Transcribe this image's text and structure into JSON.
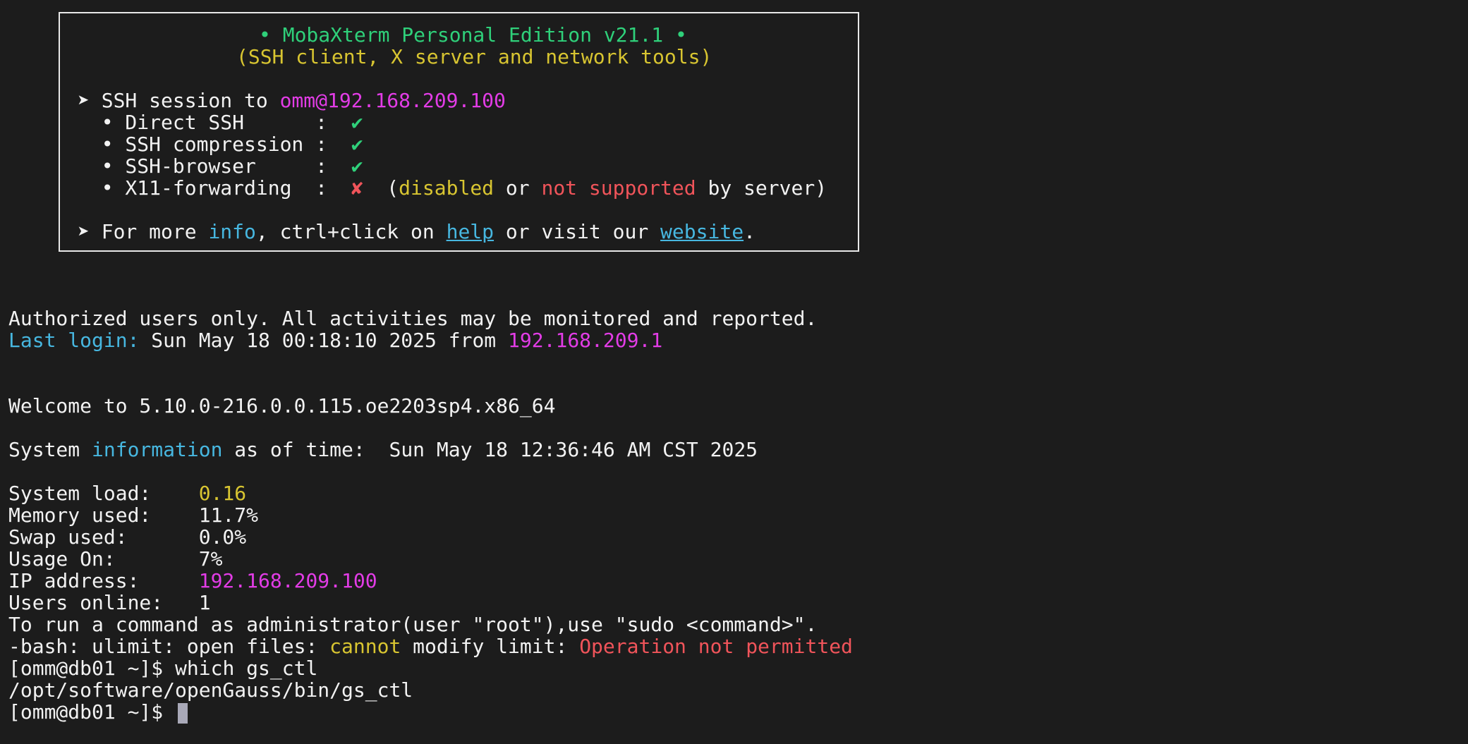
{
  "banner": {
    "title": "• MobaXterm Personal Edition v21.1 •",
    "subtitle": "(SSH client, X server and network tools)",
    "ssh_prefix": "➤ SSH session to ",
    "ssh_target": "omm@192.168.209.100",
    "features": [
      {
        "label": "  • Direct SSH      :  ",
        "mark": "✔",
        "status": "ok"
      },
      {
        "label": "  • SSH compression :  ",
        "mark": "✔",
        "status": "ok"
      },
      {
        "label": "  • SSH-browser     :  ",
        "mark": "✔",
        "status": "ok"
      },
      {
        "label": "  • X11-forwarding  :  ",
        "mark": "✘",
        "status": "fail"
      }
    ],
    "x11_note_open": "  (",
    "x11_disabled": "disabled",
    "x11_or": " or ",
    "x11_not_supported": "not supported",
    "x11_by_server": " by server)",
    "info_prefix": "➤ For more ",
    "info_word": "info",
    "info_mid": ", ctrl+click on ",
    "help_link": "help",
    "info_mid2": " or visit our ",
    "website_link": "website",
    "info_end": "."
  },
  "motd": {
    "authorized": "Authorized users only. All activities may be monitored and reported.",
    "last_login_label": "Last login:",
    "last_login_value": " Sun May 18 00:18:10 2025 from ",
    "last_login_ip": "192.168.209.1",
    "welcome": "Welcome to 5.10.0-216.0.0.115.oe2203sp4.x86_64",
    "sysinfo_prefix": "System ",
    "sysinfo_word": "information",
    "sysinfo_suffix": " as of time:  Sun May 18 12:36:46 AM CST 2025",
    "stats": [
      {
        "label": "System load:    ",
        "value": "0.16",
        "color": "yellow"
      },
      {
        "label": "Memory used:    ",
        "value": "11.7%",
        "color": "white"
      },
      {
        "label": "Swap used:      ",
        "value": "0.0%",
        "color": "white"
      },
      {
        "label": "Usage On:       ",
        "value": "7%",
        "color": "white"
      },
      {
        "label": "IP address:     ",
        "value": "192.168.209.100",
        "color": "magenta"
      },
      {
        "label": "Users online:   ",
        "value": "1",
        "color": "white"
      }
    ],
    "sudo_hint": "To run a command as administrator(user \"root\"),use \"sudo <command>\"."
  },
  "shell": {
    "ulimit_prefix": "-bash: ulimit: open files: ",
    "ulimit_cannot": "cannot",
    "ulimit_mid": " modify limit: ",
    "ulimit_error": "Operation not permitted",
    "prompt1": "[omm@db01 ~]$ ",
    "command1": "which gs_ctl",
    "output1": "/opt/software/openGauss/bin/gs_ctl",
    "prompt2": "[omm@db01 ~]$ "
  },
  "colors": {
    "background": "#1c1c1c",
    "foreground": "#f2f2f2",
    "green": "#2fd07a",
    "yellow": "#d8c531",
    "magenta": "#e23ce6",
    "cyan": "#47b7e0",
    "red": "#f0545a"
  }
}
